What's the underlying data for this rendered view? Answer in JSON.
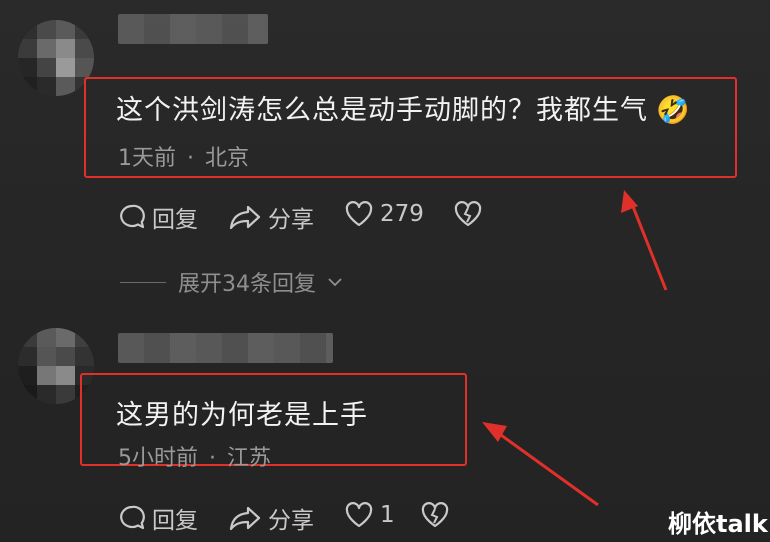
{
  "comments": [
    {
      "text": "这个洪剑涛怎么总是动手动脚的？我都生气",
      "emoji": "🤣",
      "time": "1天前",
      "separator": "·",
      "location": "北京",
      "reply_label": "回复",
      "share_label": "分享",
      "likes": "279",
      "expand_replies": "展开34条回复"
    },
    {
      "text": "这男的为何老是上手",
      "time": "5小时前",
      "separator": "·",
      "location": "江苏",
      "reply_label": "回复",
      "share_label": "分享",
      "likes": "1"
    }
  ],
  "watermark": "柳依talk",
  "colors": {
    "highlight_box": "#e0302a",
    "arrow": "#e0302a",
    "background": "#262626"
  }
}
